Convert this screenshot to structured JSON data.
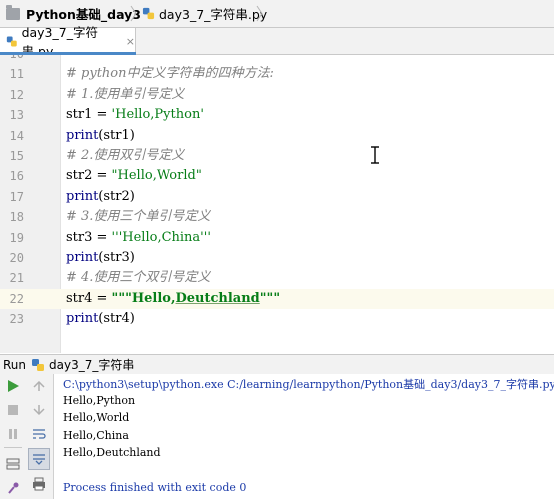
{
  "breadcrumb": {
    "project": "Python基础_day3",
    "file": "day3_7_字符串.py"
  },
  "editor_tab": {
    "label": "day3_7_字符串.py",
    "close": "×"
  },
  "code_lines": [
    {
      "num": "10",
      "text": ""
    },
    {
      "num": "11",
      "text": "# python中定义字符串的四种方法:",
      "kind": "comment"
    },
    {
      "num": "12",
      "text": "# 1.使用单引号定义",
      "kind": "comment"
    },
    {
      "num": "13",
      "pre": "str1 = ",
      "str": "'Hello,Python'"
    },
    {
      "num": "14",
      "fn": "print",
      "rest": "(str1)"
    },
    {
      "num": "15",
      "text": "# 2.使用双引号定义",
      "kind": "comment"
    },
    {
      "num": "16",
      "pre": "str2 = ",
      "str": "\"Hello,World\""
    },
    {
      "num": "17",
      "fn": "print",
      "rest": "(str2)"
    },
    {
      "num": "18",
      "text": "# 3.使用三个单引号定义",
      "kind": "comment"
    },
    {
      "num": "19",
      "pre": "str3 = ",
      "str": "'''Hello,China'''"
    },
    {
      "num": "20",
      "fn": "print",
      "rest": "(str3)"
    },
    {
      "num": "21",
      "text": "# 4.使用三个双引号定义",
      "kind": "comment"
    },
    {
      "num": "22",
      "pre": "str4 = ",
      "q1": "\"\"\"Hello,",
      "ul": "Deutchland",
      "q2": "\"\"\""
    },
    {
      "num": "23",
      "fn": "print",
      "rest": "(str4)"
    }
  ],
  "run_panel": {
    "label": "Run",
    "config": "day3_7_字符串"
  },
  "console": {
    "command": "C:\\python3\\setup\\python.exe C:/learning/learnpython/Python基础_day3/day3_7_字符串.py",
    "outputs": [
      "Hello,Python",
      "Hello,World",
      "Hello,China",
      "Hello,Deutchland"
    ],
    "exit": "Process finished with exit code 0"
  },
  "colors": {
    "accent": "#4a88c7",
    "run_green": "#3c9c3c",
    "string": "#067d17",
    "comment": "#808080"
  }
}
